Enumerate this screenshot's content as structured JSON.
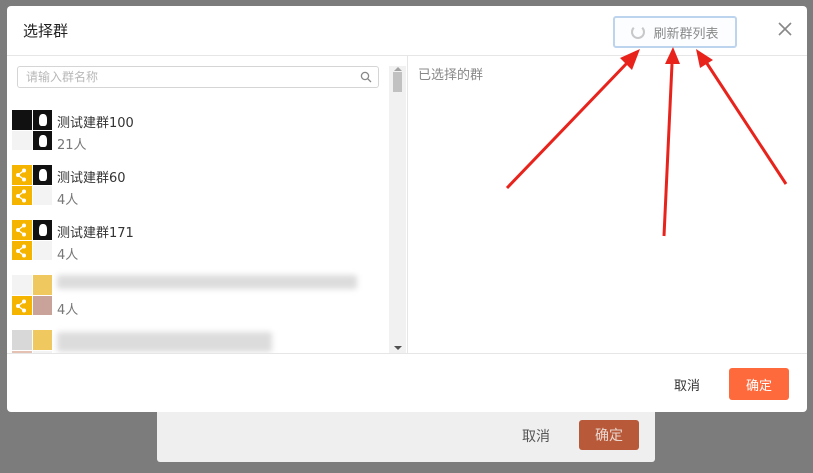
{
  "background_dialog": {
    "cancel_label": "取消",
    "confirm_label": "确定"
  },
  "modal": {
    "title": "选择群",
    "refresh_label": "刷新群列表",
    "close_icon": "close-icon",
    "search": {
      "placeholder": "请输入群名称",
      "value": "",
      "icon": "search-icon"
    },
    "groups": [
      {
        "name": "测试建群100",
        "count": "21人"
      },
      {
        "name": "测试建群60",
        "count": "4人"
      },
      {
        "name": "测试建群171",
        "count": "4人"
      },
      {
        "name": "",
        "count": "4人"
      },
      {
        "name": "",
        "count": ""
      }
    ],
    "selected_title": "已选择的群",
    "cancel_label": "取消",
    "confirm_label": "确定"
  },
  "colors": {
    "accent": "#ff6a3d",
    "share_tile": "#f5b400",
    "annotation_arrow": "#e8231c"
  }
}
